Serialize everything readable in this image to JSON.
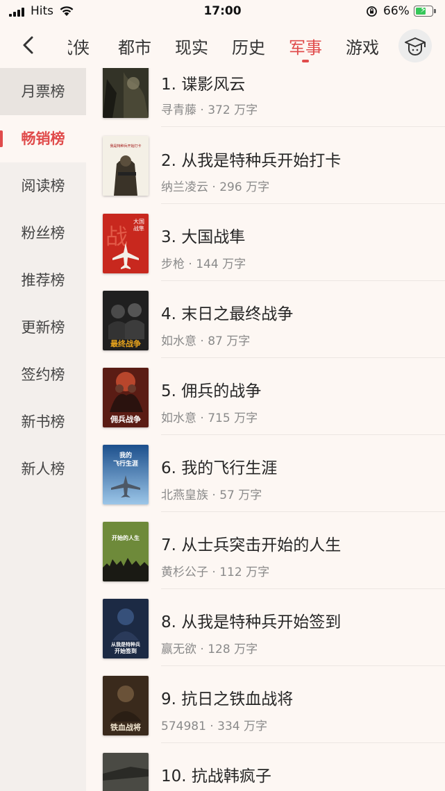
{
  "status": {
    "carrier": "Hits",
    "time": "17:00",
    "battery_pct": "66%",
    "battery_level": 0.66
  },
  "nav": {
    "tabs": [
      "武侠",
      "都市",
      "现实",
      "历史",
      "军事",
      "游戏"
    ],
    "active_tab": "军事"
  },
  "sidebar": {
    "items": [
      "月票榜",
      "畅销榜",
      "阅读榜",
      "粉丝榜",
      "推荐榜",
      "更新榜",
      "签约榜",
      "新书榜",
      "新人榜"
    ],
    "active": "畅销榜"
  },
  "books": [
    {
      "title": "1. 谍影风云",
      "author": "寻青藤",
      "words": "372 万字"
    },
    {
      "title": "2. 从我是特种兵开始打卡",
      "author": "纳兰凌云",
      "words": "296 万字"
    },
    {
      "title": "3. 大国战隼",
      "author": "步枪",
      "words": "144 万字"
    },
    {
      "title": "4. 末日之最终战争",
      "author": "如水意",
      "words": "87 万字"
    },
    {
      "title": "5. 佣兵的战争",
      "author": "如水意",
      "words": "715 万字"
    },
    {
      "title": "6. 我的飞行生涯",
      "author": "北燕皇族",
      "words": "57 万字"
    },
    {
      "title": "7. 从士兵突击开始的人生",
      "author": "黄杉公子",
      "words": "112 万字"
    },
    {
      "title": "8. 从我是特种兵开始签到",
      "author": "赢无欲",
      "words": "128 万字"
    },
    {
      "title": "9. 抗日之铁血战将",
      "author": "574981",
      "words": "334 万字"
    },
    {
      "title": "10. 抗战韩疯子",
      "author": "",
      "words": ""
    }
  ],
  "cover_art": {
    "c2": "我是特种兵开始打卡",
    "c3a": "大国",
    "c3b": "战隼",
    "c3big": "战",
    "c4": "最终战争",
    "c5": "佣兵战争",
    "c6a": "我的",
    "c6b": "飞行生涯",
    "c7": "开始的人生",
    "c8a": "从我是特种兵",
    "c8b": "开始签到",
    "c9": "铁血战将"
  },
  "colors": {
    "accent": "#e04b4b",
    "background": "#fdf7f3",
    "sidebar": "#f3efec"
  }
}
